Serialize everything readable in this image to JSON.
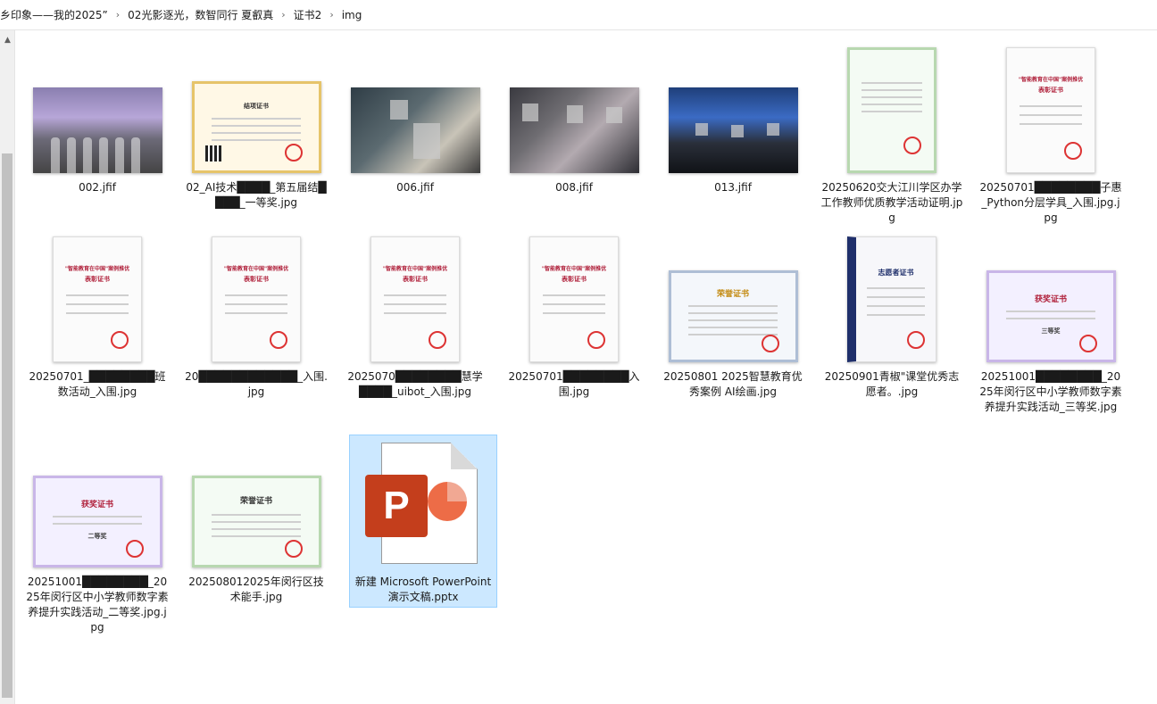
{
  "breadcrumb": {
    "items": [
      "乡印象——我的2025”",
      "02光影逐光，数智同行 夏叡真",
      "证书2",
      "img"
    ]
  },
  "files": [
    {
      "name": "002.jfif",
      "thumb": "photo"
    },
    {
      "name": "02_AI技术████_第五届结████_一等奖.jpg",
      "thumb": "certificate"
    },
    {
      "name": "006.jfif",
      "thumb": "photo"
    },
    {
      "name": "008.jfif",
      "thumb": "photo"
    },
    {
      "name": "013.jfif",
      "thumb": "photo"
    },
    {
      "name": "20250620交大江川学区办学工作教师优质教学活动证明.jpg",
      "thumb": "certificate"
    },
    {
      "name": "20250701████████子惠_Python分层学具_入围.jpg.jpg",
      "thumb": "certificate"
    },
    {
      "name": "20250701_████████班数活动_入围.jpg",
      "thumb": "certificate"
    },
    {
      "name": "20████████████_入围.jpg",
      "thumb": "certificate"
    },
    {
      "name": "2025070████████慧学████_uibot_入围.jpg",
      "thumb": "certificate"
    },
    {
      "name": "20250701████████入围.jpg",
      "thumb": "certificate"
    },
    {
      "name": "20250801 2025智慧教育优秀案例 AI绘画.jpg",
      "thumb": "certificate"
    },
    {
      "name": "20250901青椒\"课堂优秀志愿者。.jpg",
      "thumb": "certificate"
    },
    {
      "name": "20251001████████_2025年闵行区中小学教师数字素养提升实践活动_三等奖.jpg",
      "thumb": "certificate"
    },
    {
      "name": "20251001████████_2025年闵行区中小学教师数字素养提升实践活动_二等奖.jpg.jpg",
      "thumb": "certificate"
    },
    {
      "name": "202508012025年闵行区技术能手.jpg",
      "thumb": "certificate"
    },
    {
      "name": "新建 Microsoft PowerPoint 演示文稿.pptx",
      "thumb": "pptx"
    }
  ],
  "cert_text": {
    "honor": "荣誉证书",
    "award": "获奖证书",
    "commend": "表彰证书",
    "case": "\"智能教育在中国\"案例推优",
    "volunteer": "志愿者证书",
    "results": "结项证书",
    "third": "三等奖",
    "second": "二等奖"
  },
  "ppt_icon_letter": "P",
  "colors": {
    "selection": "#cce8ff",
    "selection_border": "#99d1ff",
    "ppt_red": "#c43e1c"
  }
}
